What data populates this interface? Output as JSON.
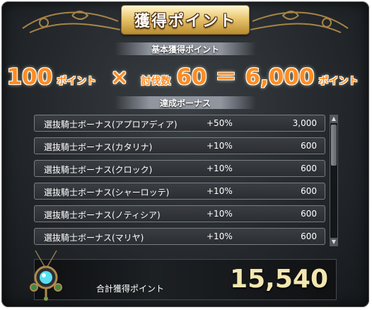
{
  "header": {
    "title": "獲得ポイント"
  },
  "basic": {
    "label": "基本獲得ポイント",
    "base_points": "100",
    "points_unit": "ポイント",
    "times_symbol": "×",
    "subjugation_label": "討伐数",
    "subjugation_count": "60",
    "equals_symbol": "＝",
    "result_points": "6,000",
    "result_unit": "ポイント"
  },
  "bonus": {
    "label": "達成ボーナス",
    "rows": [
      {
        "name": "選抜騎士ボーナス(アプロアディア)",
        "percent": "+50%",
        "points": "3,000"
      },
      {
        "name": "選抜騎士ボーナス(カタリナ)",
        "percent": "+10%",
        "points": "600"
      },
      {
        "name": "選抜騎士ボーナス(クロック)",
        "percent": "+10%",
        "points": "600"
      },
      {
        "name": "選抜騎士ボーナス(シャーロッテ)",
        "percent": "+10%",
        "points": "600"
      },
      {
        "name": "選抜騎士ボーナス(ノティシア)",
        "percent": "+10%",
        "points": "600"
      },
      {
        "name": "選抜騎士ボーナス(マリヤ)",
        "percent": "+10%",
        "points": "600"
      }
    ]
  },
  "total": {
    "label": "合計獲得ポイント",
    "value": "15,540"
  },
  "icons": {
    "pendant": "amulet-icon",
    "scroll_up": "arrow-up-icon",
    "scroll_down": "arrow-down-icon"
  },
  "colors": {
    "accent_orange": "#ff8c22",
    "gold": "#e9c66f",
    "total_value": "#f3e7b0"
  }
}
